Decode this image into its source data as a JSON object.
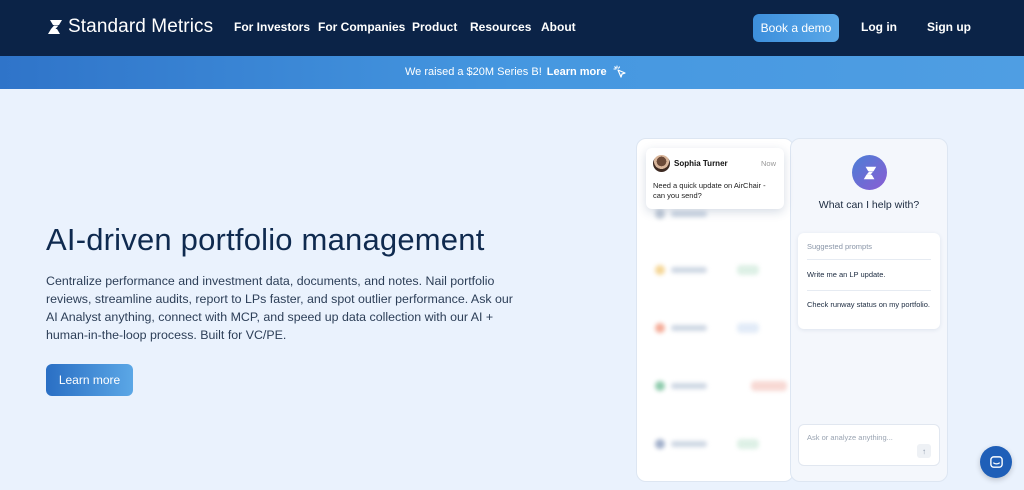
{
  "nav": {
    "brand": "Standard Metrics",
    "links": [
      "For Investors",
      "For Companies",
      "Product",
      "Resources",
      "About"
    ],
    "book_demo": "Book a demo",
    "login": "Log in",
    "signup": "Sign up"
  },
  "banner": {
    "text": "We raised a $20M Series B!",
    "link": "Learn more"
  },
  "hero": {
    "title": "AI-driven portfolio management",
    "description": "Centralize performance and investment data, documents, and notes. Nail portfolio reviews, streamline audits, report to LPs faster, and spot outlier performance. Ask our AI Analyst anything, connect with MCP, and speed up data collection with our AI + human-in-the-loop process. Built for VC/PE.",
    "cta": "Learn more"
  },
  "mockup": {
    "chat": {
      "name": "Sophia Turner",
      "time": "Now",
      "message": "Need a quick update on AirChair - can you send?"
    },
    "assistant_question": "What can I help with?",
    "suggested_prompts_label": "Suggested prompts",
    "prompts": [
      "Write me an LP update.",
      "Check runway status on my portfolio."
    ],
    "ask_placeholder": "Ask or analyze anything..."
  },
  "colors": {
    "nav_bg": "#0b2347",
    "page_bg": "#eaf2fd",
    "accent": "#3d8fdc"
  }
}
